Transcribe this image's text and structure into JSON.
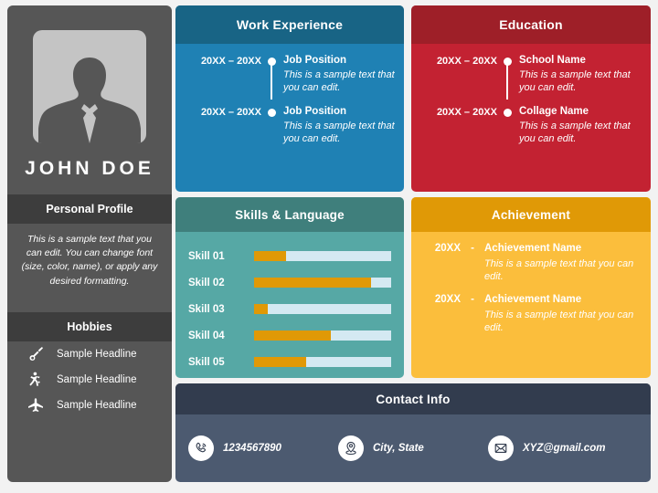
{
  "sidebar": {
    "avatar_icon": "person-silhouette-icon",
    "name": "JOHN DOE",
    "profile_heading": "Personal Profile",
    "profile_text": "This is a sample text that you can edit. You can change font (size, color, name), or apply any desired formatting.",
    "hobbies_heading": "Hobbies",
    "hobbies": [
      {
        "icon": "guitar-icon",
        "label": "Sample Headline"
      },
      {
        "icon": "sports-figure-icon",
        "label": "Sample Headline"
      },
      {
        "icon": "airplane-icon",
        "label": "Sample Headline"
      }
    ],
    "bg_color": "#565656",
    "band_color": "#3d3d3d"
  },
  "work": {
    "title": "Work Experience",
    "head_color": "#186485",
    "body_color": "#1f81b4",
    "items": [
      {
        "date": "20XX – 20XX",
        "title": "Job Position",
        "desc": "This is a sample text that you can edit."
      },
      {
        "date": "20XX – 20XX",
        "title": "Job Position",
        "desc": "This is a sample text that you can edit."
      }
    ]
  },
  "education": {
    "title": "Education",
    "head_color": "#9e1f28",
    "body_color": "#c32232",
    "items": [
      {
        "date": "20XX – 20XX",
        "title": "School Name",
        "desc": "This is a sample text that you can edit."
      },
      {
        "date": "20XX – 20XX",
        "title": "Collage Name",
        "desc": "This is a sample text that you can edit."
      }
    ]
  },
  "skills": {
    "title": "Skills & Language",
    "head_color": "#3f7f7c",
    "body_color": "#56a8a5",
    "fill_color": "#e09906",
    "track_color": "#d4e9f2",
    "items": [
      {
        "label": "Skill 01",
        "value": 23
      },
      {
        "label": "Skill 02",
        "value": 85
      },
      {
        "label": "Skill 03",
        "value": 10
      },
      {
        "label": "Skill 04",
        "value": 56
      },
      {
        "label": "Skill 05",
        "value": 38
      }
    ]
  },
  "achievement": {
    "title": "Achievement",
    "head_color": "#e09906",
    "body_color": "#fbbe3c",
    "items": [
      {
        "year": "20XX",
        "sep": "-",
        "title": "Achievement Name",
        "desc": "This is a sample text that you can edit."
      },
      {
        "year": "20XX",
        "sep": "-",
        "title": "Achievement Name",
        "desc": "This is a sample text that you can edit."
      }
    ]
  },
  "contact": {
    "title": "Contact Info",
    "head_color": "#323c4e",
    "body_color": "#4c5a70",
    "items": [
      {
        "icon": "phone-icon",
        "value": "1234567890"
      },
      {
        "icon": "location-pin-icon",
        "value": "City, State"
      },
      {
        "icon": "envelope-icon",
        "value": "XYZ@gmail.com"
      }
    ]
  }
}
